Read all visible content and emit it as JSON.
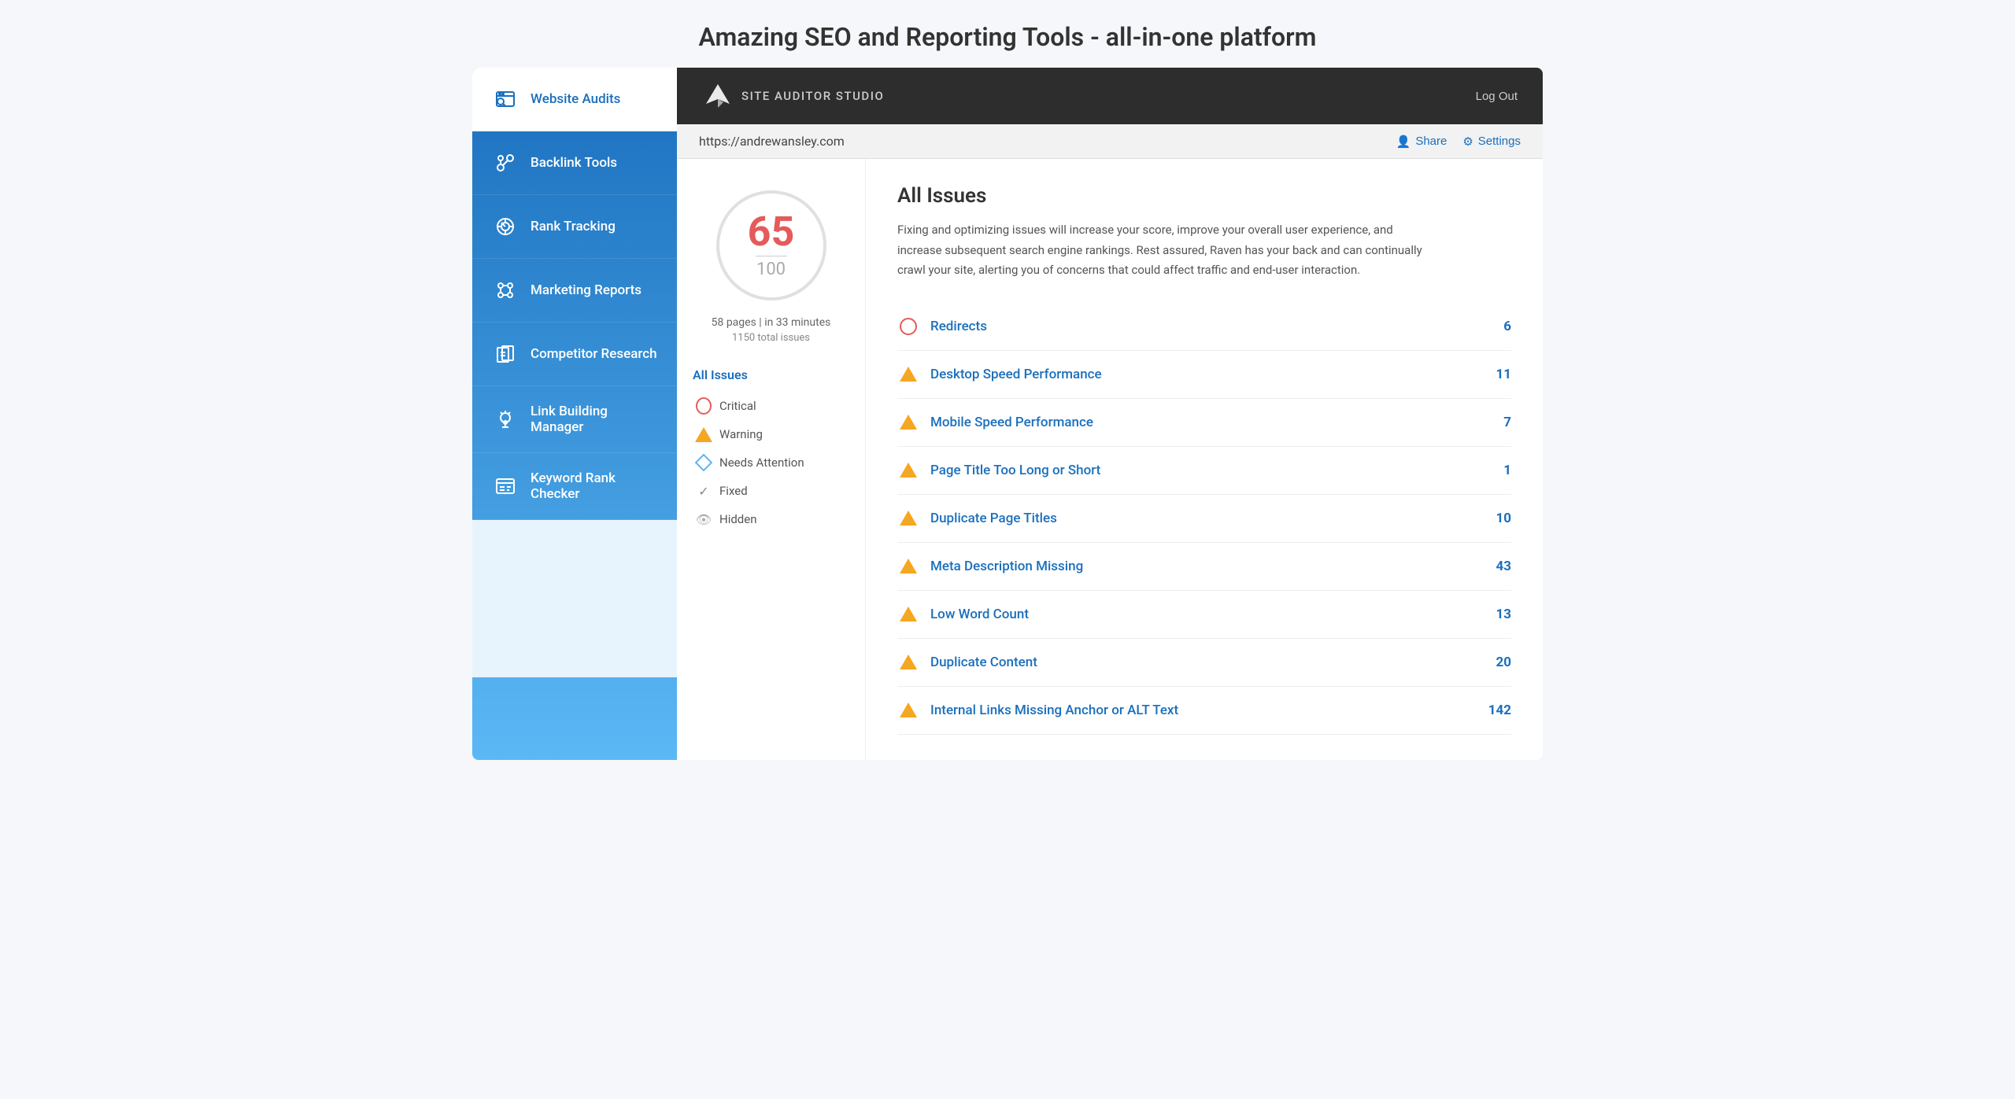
{
  "page": {
    "title": "Amazing SEO and Reporting Tools - all-in-one platform"
  },
  "sidebar": {
    "items": [
      {
        "id": "website-audits",
        "label": "Website Audits",
        "active": true
      },
      {
        "id": "backlink-tools",
        "label": "Backlink Tools",
        "active": false
      },
      {
        "id": "rank-tracking",
        "label": "Rank Tracking",
        "active": false
      },
      {
        "id": "marketing-reports",
        "label": "Marketing Reports",
        "active": false
      },
      {
        "id": "competitor-research",
        "label": "Competitor Research",
        "active": false
      },
      {
        "id": "link-building-manager",
        "label": "Link Building Manager",
        "active": false
      },
      {
        "id": "keyword-rank-checker",
        "label": "Keyword Rank Checker",
        "active": false
      }
    ]
  },
  "header": {
    "app_name": "SITE AUDITOR STUDIO",
    "logout_label": "Log Out",
    "url": "https://andrewansley.com",
    "share_label": "Share",
    "settings_label": "Settings"
  },
  "score": {
    "value": "65",
    "max": "100",
    "pages": "58 pages",
    "time": "in 33 minutes",
    "total_issues": "1150 total issues"
  },
  "filters": {
    "all_issues_label": "All Issues",
    "items": [
      {
        "id": "critical",
        "label": "Critical",
        "type": "critical"
      },
      {
        "id": "warning",
        "label": "Warning",
        "type": "warning"
      },
      {
        "id": "needs-attention",
        "label": "Needs Attention",
        "type": "needs"
      },
      {
        "id": "fixed",
        "label": "Fixed",
        "type": "fixed"
      },
      {
        "id": "hidden",
        "label": "Hidden",
        "type": "hidden"
      }
    ]
  },
  "issues": {
    "title": "All Issues",
    "description": "Fixing and optimizing issues will increase your score, improve your overall user experience, and increase subsequent search engine rankings. Rest assured, Raven has your back and can continually crawl your site, alerting you of concerns that could affect traffic and end-user interaction.",
    "rows": [
      {
        "label": "Redirects",
        "count": "6",
        "type": "critical"
      },
      {
        "label": "Desktop Speed Performance",
        "count": "11",
        "type": "warning"
      },
      {
        "label": "Mobile Speed Performance",
        "count": "7",
        "type": "warning"
      },
      {
        "label": "Page Title Too Long or Short",
        "count": "1",
        "type": "warning"
      },
      {
        "label": "Duplicate Page Titles",
        "count": "10",
        "type": "warning"
      },
      {
        "label": "Meta Description Missing",
        "count": "43",
        "type": "warning"
      },
      {
        "label": "Low Word Count",
        "count": "13",
        "type": "warning"
      },
      {
        "label": "Duplicate Content",
        "count": "20",
        "type": "warning"
      },
      {
        "label": "Internal Links Missing Anchor or ALT Text",
        "count": "142",
        "type": "warning"
      }
    ]
  }
}
